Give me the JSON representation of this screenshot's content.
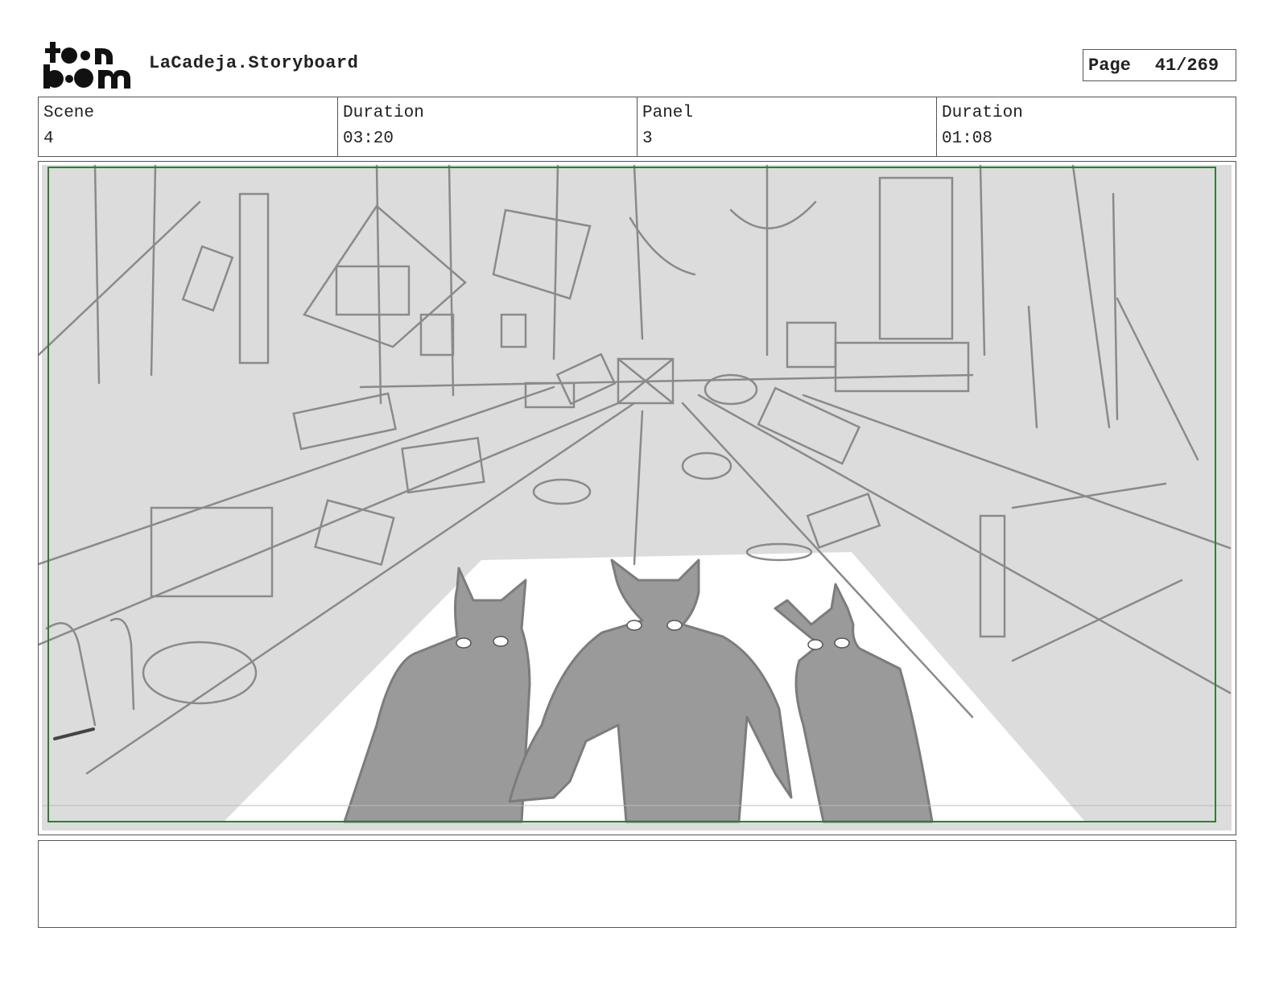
{
  "header": {
    "logo_text": "toon boom",
    "project_title": "LaCadeja.Storyboard",
    "page_label": "Page",
    "page_value": "41/269"
  },
  "info": {
    "scene_label": "Scene",
    "scene_value": "4",
    "scene_duration_label": "Duration",
    "scene_duration_value": "03:20",
    "panel_label": "Panel",
    "panel_value": "3",
    "panel_duration_label": "Duration",
    "panel_duration_value": "01:08"
  },
  "notes": {
    "text": ""
  },
  "colors": {
    "safe_frame": "#2e7d32",
    "sketch_bg": "#dcdcdc",
    "figure": "#9a9a9a"
  }
}
